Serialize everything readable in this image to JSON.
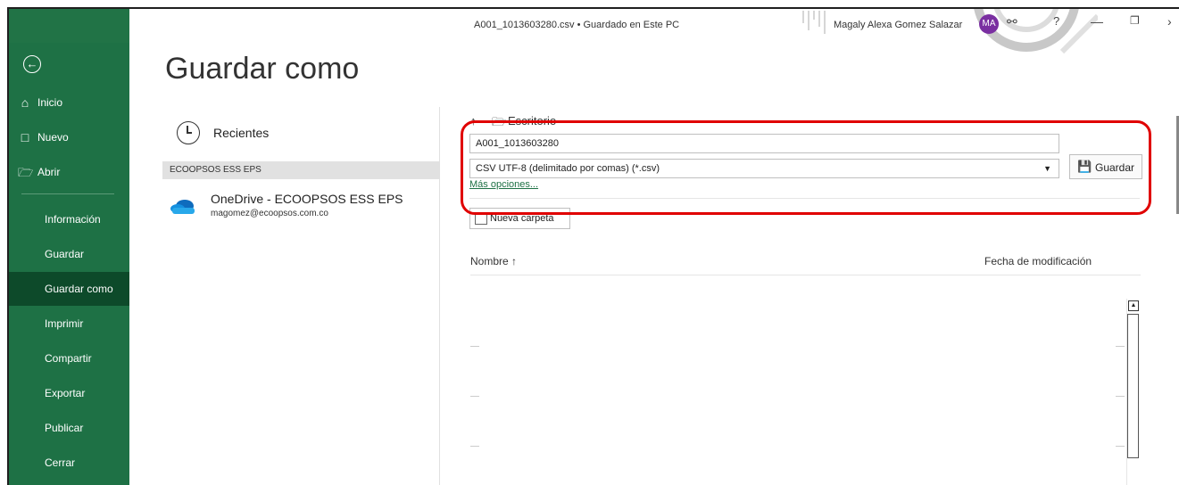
{
  "window": {
    "title": "A001_1013603280.csv • Guardado en Este PC",
    "user_name": "Magaly Alexa Gomez Salazar",
    "user_initials": "MA"
  },
  "sidebar": {
    "back_icon": "arrow-left-circle-icon",
    "items": [
      {
        "label": "Inicio",
        "icon": "home-icon"
      },
      {
        "label": "Nuevo",
        "icon": "document-icon"
      },
      {
        "label": "Abrir",
        "icon": "folder-open-icon"
      }
    ],
    "sub_items": [
      {
        "label": "Información"
      },
      {
        "label": "Guardar"
      },
      {
        "label": "Guardar como",
        "active": true
      },
      {
        "label": "Imprimir"
      },
      {
        "label": "Compartir"
      },
      {
        "label": "Exportar"
      },
      {
        "label": "Publicar"
      },
      {
        "label": "Cerrar"
      }
    ]
  },
  "main": {
    "title": "Guardar como",
    "locations": {
      "recent_label": "Recientes",
      "group_header": "ECOOPSOS ESS EPS",
      "onedrive_name": "OneDrive - ECOOPSOS ESS EPS",
      "onedrive_email": "magomez@ecoopsos.com.co"
    },
    "save_panel": {
      "path": "Escritorio",
      "filename": "A001_1013603280",
      "filetype": "CSV UTF-8 (delimitado por comas) (*.csv)",
      "save_label": "Guardar",
      "more_options": "Más opciones...",
      "new_folder_label": "Nueva carpeta",
      "col_name": "Nombre",
      "col_date": "Fecha de modificación"
    }
  },
  "colors": {
    "sidebar": "#1e7145",
    "active_item": "#0d4a2a",
    "highlight": "#e00000"
  }
}
